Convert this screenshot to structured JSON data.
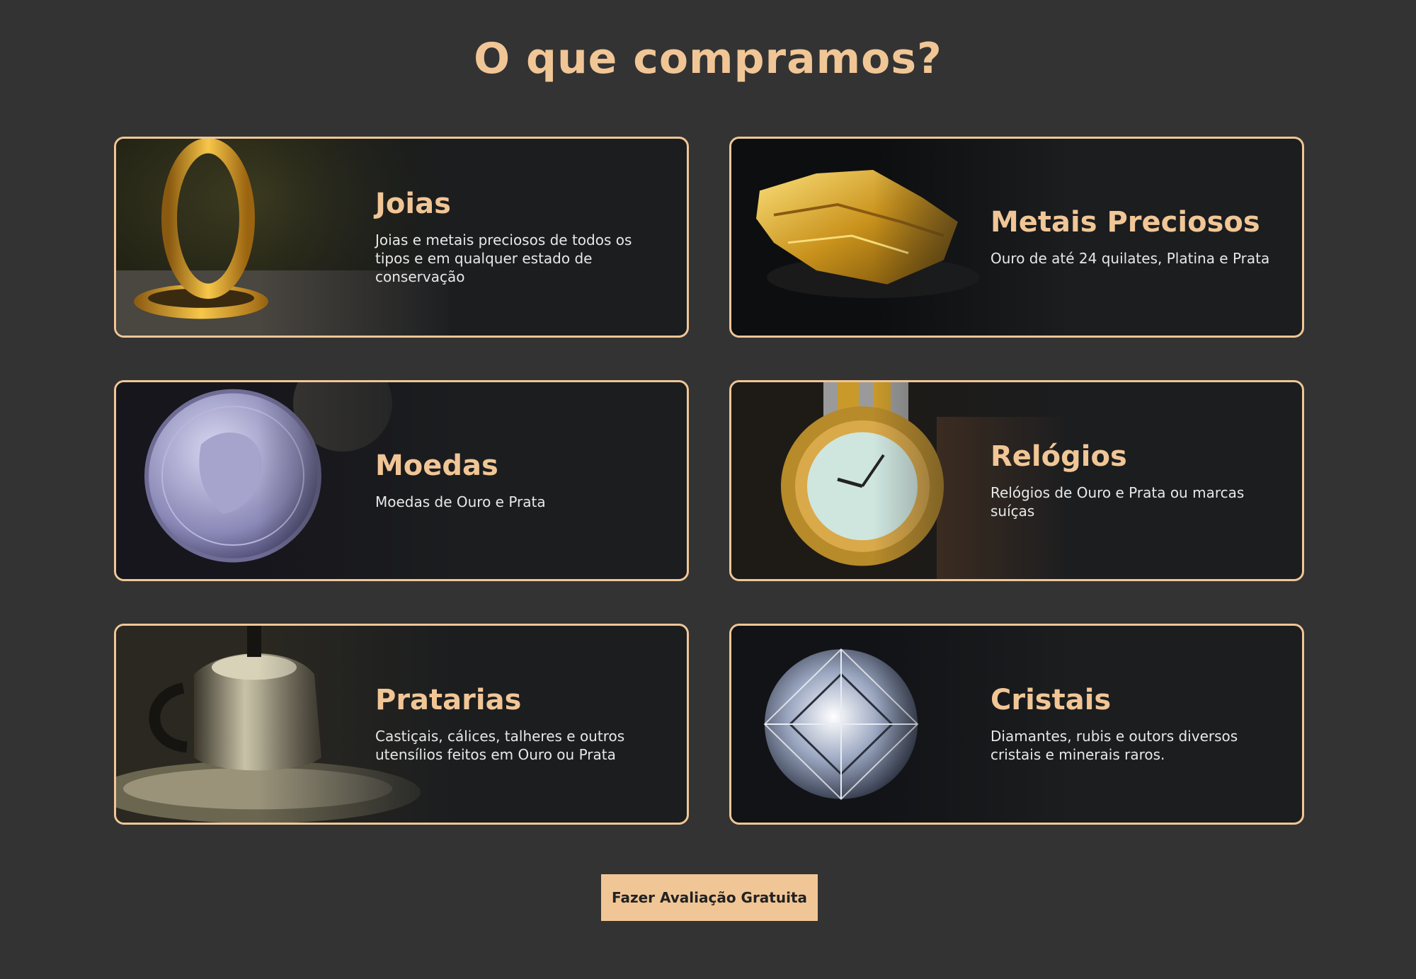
{
  "section": {
    "title": "O que compramos?"
  },
  "cards": [
    {
      "title": "Joias",
      "description": "Joias e metais preciosos de todos os tipos e em qualquer estado de conservação",
      "icon": "gold-ring-image"
    },
    {
      "title": "Metais Preciosos",
      "description": "Ouro de até 24 quilates, Platina e Prata",
      "icon": "gold-nugget-image"
    },
    {
      "title": "Moedas",
      "description": "Moedas de Ouro e Prata",
      "icon": "silver-coin-image"
    },
    {
      "title": "Relógios",
      "description": "Relógios de Ouro e Prata ou marcas suíças",
      "icon": "gold-watch-image"
    },
    {
      "title": "Pratarias",
      "description": "Castiçais, cálices, talheres e outros utensílios feitos em Ouro ou Prata",
      "icon": "silver-teapot-image"
    },
    {
      "title": "Cristais",
      "description": "Diamantes, rubis e outors diversos cristais e minerais raros.",
      "icon": "diamond-image"
    }
  ],
  "cta": {
    "label": "Fazer Avaliação Gratuita"
  },
  "colors": {
    "accent": "#f1c696",
    "background": "#333333",
    "card": "#1b1d1f"
  }
}
